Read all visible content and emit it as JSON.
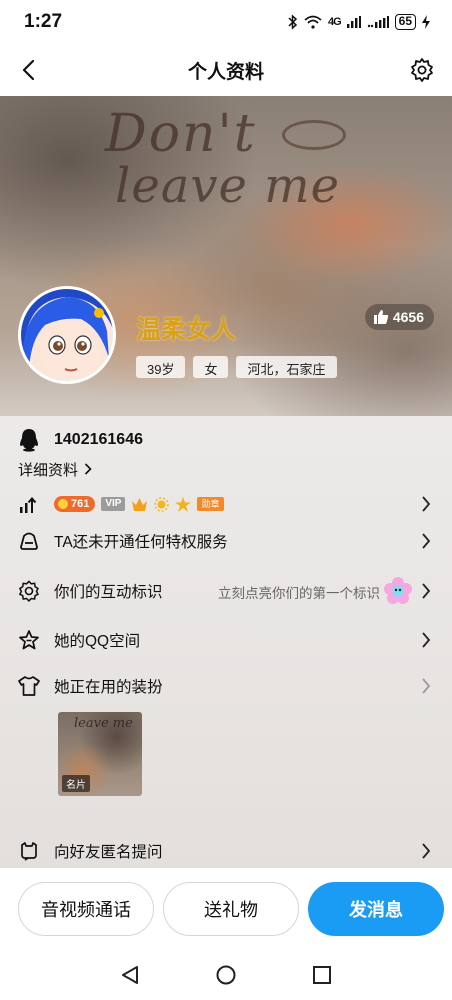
{
  "status_bar": {
    "time": "1:27",
    "signal_1": "4G",
    "battery": "65"
  },
  "header": {
    "title": "个人资料"
  },
  "profile": {
    "cover_text_line1": "Don't",
    "cover_text_line2": "leave me",
    "nickname": "温柔女人",
    "age": "39岁",
    "gender": "女",
    "location": "河北，石家庄",
    "likes": "4656",
    "qq_number": "1402161646",
    "detail_link": "详细资料"
  },
  "level_row": {
    "level": "761",
    "vip_label": "VIP",
    "medal_label": "勋章"
  },
  "rows": {
    "privilege": "TA还未开通任何特权服务",
    "interaction": "你们的互动标识",
    "interaction_hint": "立刻点亮你们的第一个标识",
    "qzone": "她的QQ空间",
    "outfit": "她正在用的装扮",
    "card_label": "名片",
    "card_scribble": "leave me",
    "anon_question": "向好友匿名提问"
  },
  "actions": {
    "call": "音视频通话",
    "gift": "送礼物",
    "message": "发消息"
  },
  "colors": {
    "primary": "#1a9cf5",
    "nickname": "#d9a018",
    "level_badge": "#f06a2b"
  }
}
